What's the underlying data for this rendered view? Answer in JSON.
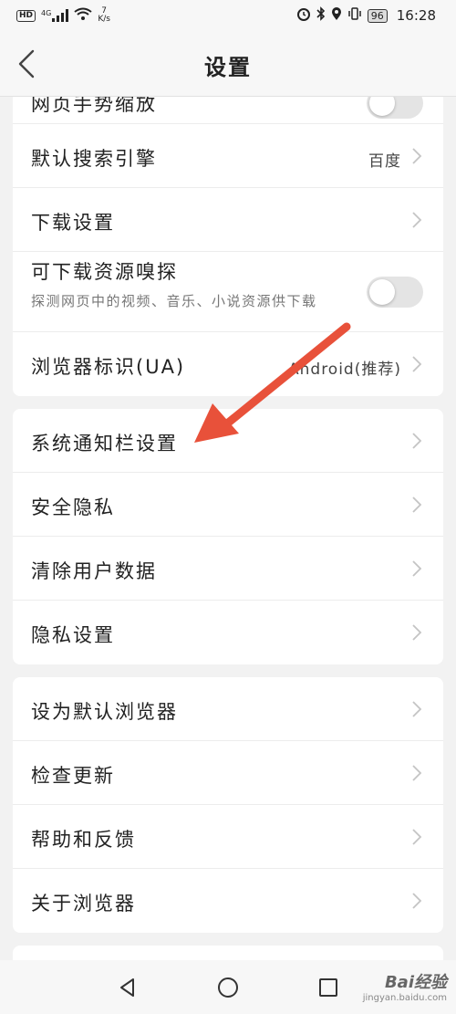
{
  "status_bar": {
    "hd": "HD",
    "network": "4G",
    "speed_value": "7",
    "speed_unit": "K/s",
    "battery": "96",
    "time": "16:28"
  },
  "header": {
    "title": "设置"
  },
  "cards": {
    "browsing": {
      "rows": [
        {
          "label": "网页手势缩放",
          "control": "toggle",
          "toggle_on": false
        },
        {
          "label": "默认搜索引擎",
          "value": "百度"
        },
        {
          "label": "下载设置"
        },
        {
          "label": "可下载资源嗅探",
          "sub": "探测网页中的视频、音乐、小说资源供下载",
          "control": "toggle",
          "toggle_on": false
        },
        {
          "label": "浏览器标识(UA)",
          "value": "Android(推荐)"
        }
      ]
    },
    "system": {
      "rows": [
        {
          "label": "系统通知栏设置"
        },
        {
          "label": "安全隐私"
        },
        {
          "label": "清除用户数据"
        },
        {
          "label": "隐私设置"
        }
      ]
    },
    "about": {
      "rows": [
        {
          "label": "设为默认浏览器"
        },
        {
          "label": "检查更新"
        },
        {
          "label": "帮助和反馈"
        },
        {
          "label": "关于浏览器"
        }
      ]
    }
  },
  "annotation": {
    "arrow_color": "#e8513a"
  },
  "watermark": {
    "brand": "Bai经验",
    "url": "jingyan.baidu.com"
  },
  "colors": {
    "background": "#f2f2f2",
    "card": "#ffffff",
    "divider": "#ececec"
  }
}
